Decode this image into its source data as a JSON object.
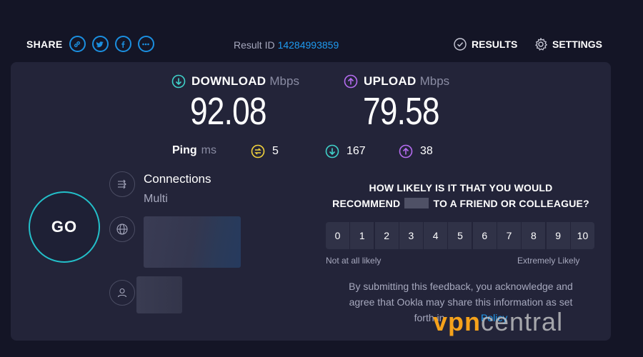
{
  "header": {
    "share_label": "SHARE",
    "share_icons": [
      "link-icon",
      "twitter-icon",
      "facebook-icon",
      "more-icon"
    ],
    "result_id_label": "Result ID",
    "result_id_value": "14284993859",
    "results_label": "RESULTS",
    "settings_label": "SETTINGS"
  },
  "download": {
    "label": "DOWNLOAD",
    "unit": "Mbps",
    "value": "92.08",
    "color": "#3fd1c9"
  },
  "upload": {
    "label": "UPLOAD",
    "unit": "Mbps",
    "value": "79.58",
    "color": "#b56cf0"
  },
  "ping": {
    "label": "Ping",
    "unit": "ms",
    "idle": "5",
    "download": "167",
    "upload": "38",
    "idle_color": "#f2d33c"
  },
  "go_label": "GO",
  "connections": {
    "title": "Connections",
    "mode": "Multi"
  },
  "survey": {
    "question_part1": "HOW LIKELY IS IT THAT YOU WOULD",
    "question_part2a": "RECOMMEND",
    "question_part2b": "TO A FRIEND OR COLLEAGUE?",
    "scale": [
      "0",
      "1",
      "2",
      "3",
      "4",
      "5",
      "6",
      "7",
      "8",
      "9",
      "10"
    ],
    "low_label": "Not at all likely",
    "high_label": "Extremely Likely",
    "disclaimer_1": "By submitting this feedback, you acknowledge and",
    "disclaimer_2": "agree that Ookla may share this information as set",
    "disclaimer_3": "forth in",
    "disclaimer_link": "Policy"
  },
  "watermark": {
    "vpn": "vpn",
    "central": "central"
  },
  "colors": {
    "accent_blue": "#1f9aef",
    "go_ring": "#23bfc9",
    "background": "#141526",
    "card": "#232439"
  }
}
